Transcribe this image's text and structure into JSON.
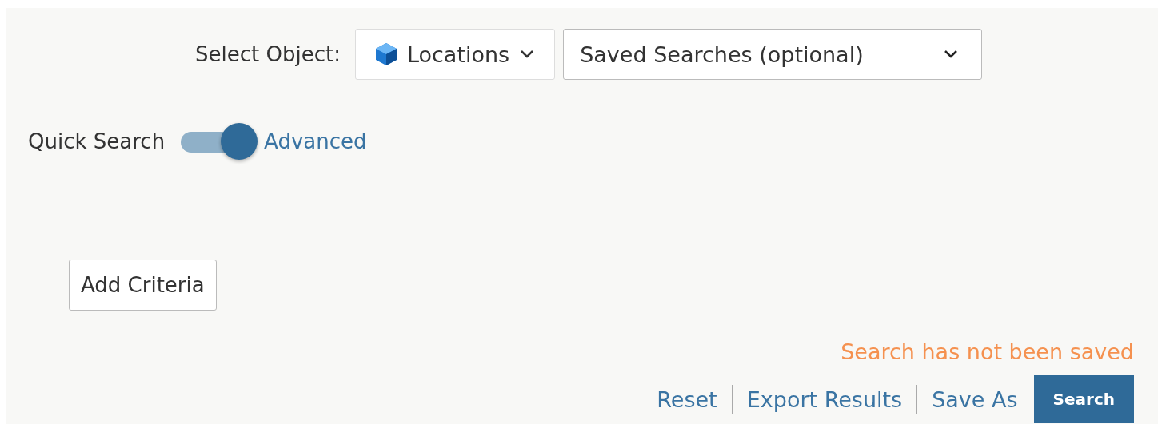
{
  "object_select": {
    "label": "Select Object:",
    "value": "Locations"
  },
  "saved_searches": {
    "placeholder": "Saved Searches (optional)"
  },
  "mode_toggle": {
    "left_label": "Quick Search",
    "right_label": "Advanced",
    "on": true
  },
  "add_criteria": "Add Criteria",
  "status": "Search has not been saved",
  "actions": [
    {
      "kind": "link",
      "label": "Reset"
    },
    {
      "kind": "link",
      "label": "Export Results"
    },
    {
      "kind": "link",
      "label": "Save As"
    },
    {
      "kind": "primary",
      "label": "Search"
    }
  ]
}
